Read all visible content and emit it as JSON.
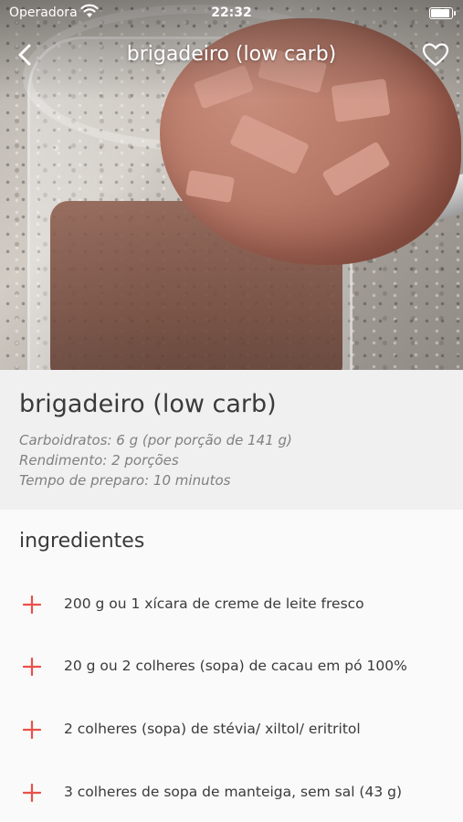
{
  "status_bar": {
    "carrier": "Operadora",
    "time": "22:32"
  },
  "nav": {
    "title": "brigadeiro (low carb)",
    "back_icon": "chevron-left-icon",
    "favorite_icon": "heart-outline-icon"
  },
  "recipe": {
    "title": "brigadeiro (low carb)",
    "carbs": "Carboidratos: 6 g (por porção de 141 g)",
    "yield": "Rendimento: 2 porções",
    "prep_time": "Tempo de preparo: 10 minutos"
  },
  "ingredients": {
    "heading": "ingredientes",
    "items": [
      "200 g ou 1 xícara de creme de leite fresco",
      "20 g ou 2 colheres (sopa) de cacau em pó 100%",
      "2 colheres (sopa) de stévia/ xiltol/ eritritol",
      "3 colheres de sopa de manteiga, sem sal (43 g)"
    ]
  },
  "colors": {
    "accent": "#e8514a",
    "text": "#3a3a3a",
    "meta_text": "#808080"
  }
}
